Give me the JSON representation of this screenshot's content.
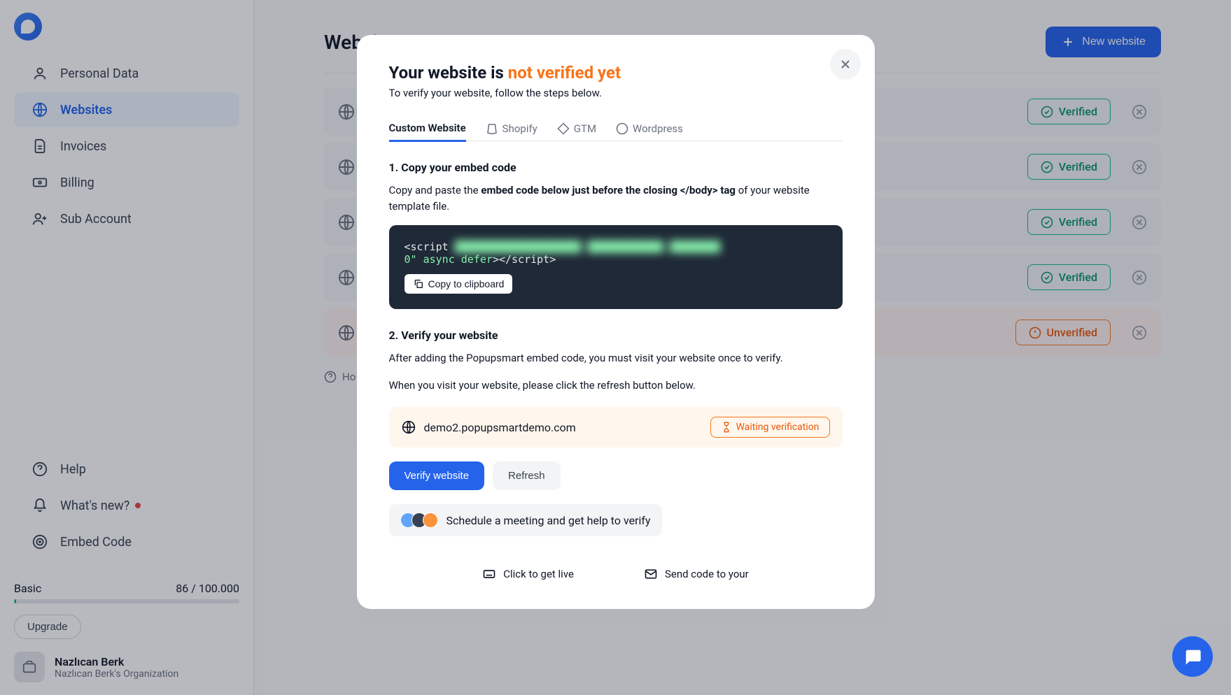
{
  "sidebar": {
    "items": [
      {
        "label": "Personal Data"
      },
      {
        "label": "Websites"
      },
      {
        "label": "Invoices"
      },
      {
        "label": "Billing"
      },
      {
        "label": "Sub Account"
      }
    ],
    "secondary": [
      {
        "label": "Help"
      },
      {
        "label": "What's new?"
      },
      {
        "label": "Embed Code"
      }
    ]
  },
  "plan": {
    "name": "Basic",
    "usage": "86 / 100.000",
    "upgrade": "Upgrade"
  },
  "profile": {
    "name": "Nazlıcan Berk",
    "org": "Nazlıcan Berk's Organization"
  },
  "page": {
    "title": "Websites",
    "newBtn": "New website",
    "howLink": "Ho"
  },
  "sites": [
    {
      "status": "Verified"
    },
    {
      "status": "Verified"
    },
    {
      "status": "Verified"
    },
    {
      "status": "Verified"
    },
    {
      "status": "Unverified"
    }
  ],
  "modal": {
    "titlePrefix": "Your website is ",
    "titleHighlight": "not verified yet",
    "subtitle": "To verify your website, follow the steps below.",
    "tabs": [
      {
        "label": "Custom Website"
      },
      {
        "label": "Shopify"
      },
      {
        "label": "GTM"
      },
      {
        "label": "Wordpress"
      }
    ],
    "step1Title": "1. Copy your embed code",
    "step1TextA": "Copy and paste the ",
    "step1TextBold": "embed code below just before the closing </body> tag",
    "step1TextB": " of your website template file.",
    "codePrefix": "<script ",
    "codeBlur": "████████████████████  ████████████  ████████",
    "codeSuffixA": "0\"",
    "codeSuffixB": " async defer",
    "codeSuffixC": "></script>",
    "copyBtn": "Copy to clipboard",
    "step2Title": "2. Verify your website",
    "step2TextA": "After adding the Popupsmart embed code, you must visit your website once to verify.",
    "step2TextB": "When you visit your website, please click the refresh button below.",
    "domain": "demo2.popupsmartdemo.com",
    "waitLabel": "Waiting verification",
    "verifyBtn": "Verify website",
    "refreshBtn": "Refresh",
    "scheduleText": "Schedule a meeting and get help to verify",
    "bottomA": "Click to get live",
    "bottomB": "Send code to your"
  }
}
